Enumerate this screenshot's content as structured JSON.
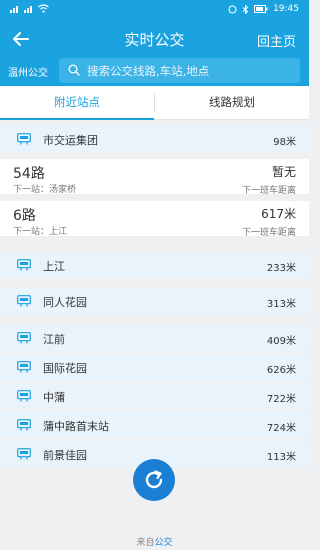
{
  "status_bar": {
    "time": "19:45"
  },
  "header": {
    "title": "实时公交",
    "home_label": "回主页"
  },
  "search": {
    "city": "温州公交",
    "placeholder": "搜索公交线路,车站,地点"
  },
  "tabs": [
    {
      "label": "附近站点",
      "active": true
    },
    {
      "label": "线路规划",
      "active": false
    }
  ],
  "nearby": {
    "expanded_stop": {
      "name": "市交运集团",
      "distance": "98米"
    },
    "routes": [
      {
        "name": "54路",
        "next_stop": "下一站：汤家桥",
        "eta": "暂无",
        "eta_label": "下一班车距离"
      },
      {
        "name": "6路",
        "next_stop": "下一站：上江",
        "eta": "617米",
        "eta_label": "下一班车距离"
      }
    ],
    "stops": [
      {
        "name": "上江",
        "distance": "233米"
      },
      {
        "name": "同人花园",
        "distance": "313米"
      },
      {
        "name": "江前",
        "distance": "409米"
      },
      {
        "name": "国际花园",
        "distance": "626米"
      },
      {
        "name": "中蒲",
        "distance": "722米"
      },
      {
        "name": "蒲中路首末站",
        "distance": "724米"
      },
      {
        "name": "前景佳园",
        "distance": "113米"
      }
    ]
  },
  "footer": {
    "prefix": "来自",
    "brand": "公交"
  },
  "colors": {
    "primary": "#1ba3e0",
    "refresh": "#1b7fd4",
    "stop_bg": "#e8f3fb"
  }
}
